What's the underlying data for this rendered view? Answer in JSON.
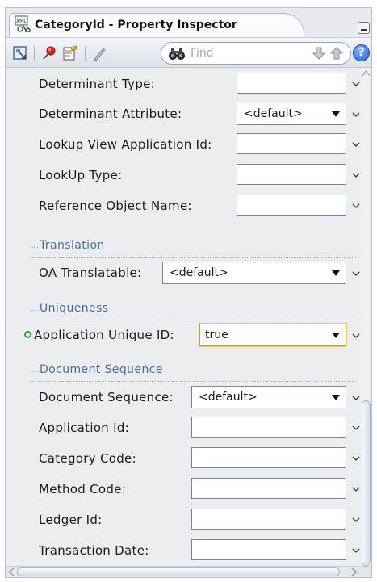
{
  "window": {
    "title": "CategoryId - Property Inspector",
    "icon": "xml-attribute-icon"
  },
  "toolbar": {
    "icons": [
      "select-node-icon",
      "pin-icon",
      "edit-properties-icon",
      "pencil-icon",
      "binoculars-icon"
    ],
    "find_placeholder": "Find",
    "next_icon": "arrow-down-icon",
    "prev_icon": "arrow-up-icon",
    "help_icon": "help-icon",
    "help_glyph": "?"
  },
  "properties": {
    "determinant_type": {
      "label": "Determinant Type:",
      "value": ""
    },
    "determinant_attribute": {
      "label": "Determinant Attribute:",
      "value": "<default>"
    },
    "lookup_view_application_id": {
      "label": "Lookup View Application Id:",
      "value": ""
    },
    "lookup_type": {
      "label": "LookUp Type:",
      "value": ""
    },
    "reference_object_name": {
      "label": "Reference Object Name:",
      "value": ""
    }
  },
  "translation": {
    "section_title": "Translation",
    "oa_translatable": {
      "label": "OA Translatable:",
      "value": "<default>"
    }
  },
  "uniqueness": {
    "section_title": "Uniqueness",
    "application_unique_id": {
      "label": "Application Unique ID:",
      "value": "true",
      "modified": true
    }
  },
  "document_sequence": {
    "section_title": "Document Sequence",
    "document_sequence": {
      "label": "Document Sequence:",
      "value": "<default>"
    },
    "application_id": {
      "label": "Application Id:",
      "value": ""
    },
    "category_code": {
      "label": "Category Code:",
      "value": ""
    },
    "method_code": {
      "label": "Method Code:",
      "value": ""
    },
    "ledger_id": {
      "label": "Ledger Id:",
      "value": ""
    },
    "transaction_date": {
      "label": "Transaction Date:",
      "value": ""
    }
  },
  "colors": {
    "section_title": "#4a6d96",
    "modified_indicator": "#3f9a3f",
    "focus_border": "#d79a2a",
    "panel_bg": "#ebedf1"
  }
}
